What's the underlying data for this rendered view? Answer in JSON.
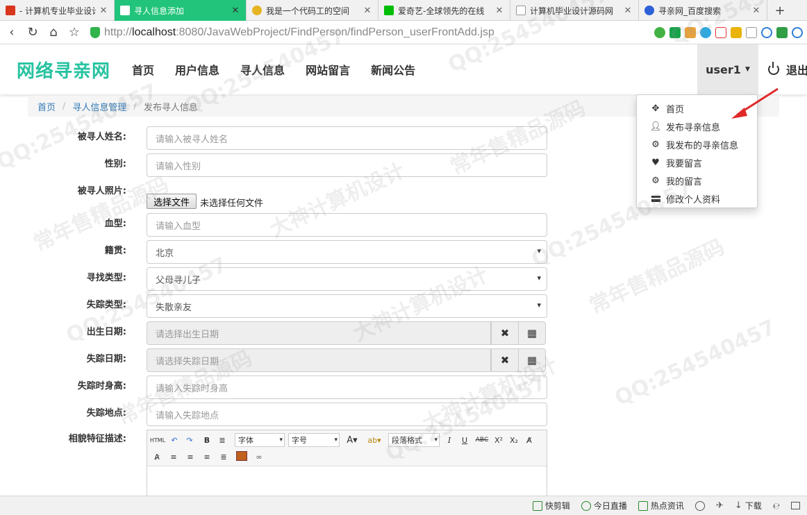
{
  "browser": {
    "tabs": [
      {
        "title": "- 计算机专业毕业设计资",
        "favicon_color": "#d9361e",
        "active": false
      },
      {
        "title": "寻人信息添加",
        "favicon_color": "#ffffff",
        "active": true,
        "bg": "#21c47a"
      },
      {
        "title": "我是一个代码工的空间",
        "favicon_color": "#e6b422",
        "active": false
      },
      {
        "title": "爱奇艺-全球领先的在线",
        "favicon_color": "#00be06",
        "active": false
      },
      {
        "title": "计算机毕业设计源码网",
        "favicon_color": "#cccccc",
        "active": false
      },
      {
        "title": "寻亲网_百度搜索",
        "favicon_color": "#2e60d8",
        "active": false
      }
    ],
    "new_tab": "+",
    "url_host": "localhost",
    "url_prefix": "http://",
    "url_rest": ":8080/JavaWebProject/FindPerson/findPerson_userFrontAdd.jsp"
  },
  "site": {
    "brand": "网络寻亲网",
    "brand_color": "#27c2a0",
    "menu": [
      "首页",
      "用户信息",
      "寻人信息",
      "网站留言",
      "新闻公告"
    ],
    "user": "user1",
    "logout": "退出"
  },
  "breadcrumb": {
    "home": "首页",
    "section": "寻人信息管理",
    "current": "发布寻人信息"
  },
  "form": {
    "name_label": "被寻人姓名:",
    "name_placeholder": "请输入被寻人姓名",
    "sex_label": "性别:",
    "sex_placeholder": "请输入性别",
    "photo_label": "被寻人照片:",
    "photo_button": "选择文件",
    "photo_status": "未选择任何文件",
    "blood_label": "血型:",
    "blood_placeholder": "请输入血型",
    "native_label": "籍贯:",
    "native_value": "北京",
    "findtype_label": "寻找类型:",
    "findtype_value": "父母寻儿子",
    "losttype_label": "失踪类型:",
    "losttype_value": "失散亲友",
    "birth_label": "出生日期:",
    "birth_placeholder": "请选择出生日期",
    "lostdate_label": "失踪日期:",
    "lostdate_placeholder": "请选择失踪日期",
    "height_label": "失踪时身高:",
    "height_placeholder": "请输入失踪时身高",
    "place_label": "失踪地点:",
    "place_placeholder": "请输入失踪地点",
    "desc_label": "相貌特征描述:"
  },
  "editor": {
    "html_btn": "HTML",
    "font_family": "字体",
    "font_size": "字号",
    "paragraph": "段落格式"
  },
  "dropdown": [
    {
      "label": "首页",
      "icon": "move-icon"
    },
    {
      "label": "发布寻亲信息",
      "icon": "user-icon"
    },
    {
      "label": "我发布的寻亲信息",
      "icon": "cog-icon"
    },
    {
      "label": "我要留言",
      "icon": "heart-icon"
    },
    {
      "label": "我的留言",
      "icon": "cog-icon"
    },
    {
      "label": "修改个人资料",
      "icon": "card-icon"
    }
  ],
  "statusbar": [
    "快剪辑",
    "今日直播",
    "热点资讯",
    "下载"
  ],
  "watermarks": [
    "QQ:254540457",
    "常年售精品源码",
    "大神计算机设计"
  ]
}
